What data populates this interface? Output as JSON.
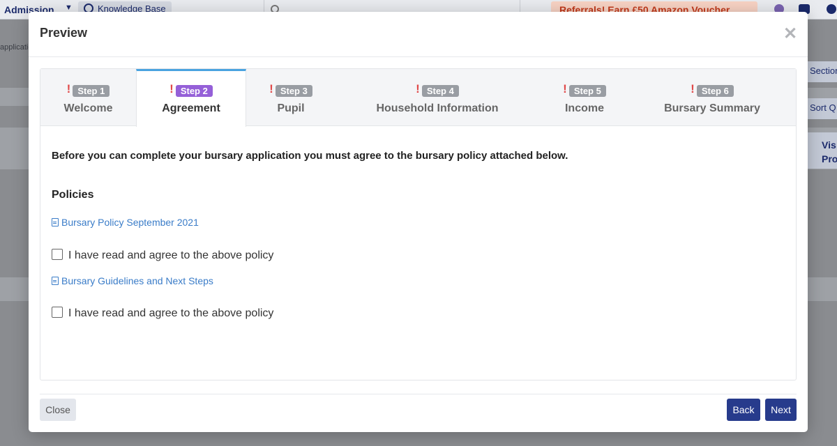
{
  "background": {
    "app_menu": "Admission",
    "knowledge_base": "Knowledge Base",
    "referral_banner": "Referrals! Earn £50 Amazon Voucher",
    "left_partial_text": "applicatio",
    "right_button_1": "Section",
    "right_button_2": "Sort Q",
    "right_column_line1": "Vis",
    "right_column_line2": "Pro"
  },
  "modal": {
    "title": "Preview",
    "tabs": [
      {
        "step": "Step 1",
        "label": "Welcome",
        "warning": "!"
      },
      {
        "step": "Step 2",
        "label": "Agreement",
        "warning": "!"
      },
      {
        "step": "Step 3",
        "label": "Pupil",
        "warning": "!"
      },
      {
        "step": "Step 4",
        "label": "Household Information",
        "warning": "!"
      },
      {
        "step": "Step 5",
        "label": "Income",
        "warning": "!"
      },
      {
        "step": "Step 6",
        "label": "Bursary Summary",
        "warning": "!"
      }
    ],
    "active_tab": "Step 2",
    "intro": "Before you can complete your bursary application you must agree to the bursary policy attached below.",
    "policies_heading": "Policies",
    "policies": [
      {
        "link": "Bursary Policy September 2021",
        "agree_label": "I have read and agree to the above policy",
        "checked": false
      },
      {
        "link": "Bursary Guidelines and Next Steps",
        "agree_label": "I have read and agree to the above policy",
        "checked": false
      }
    ],
    "buttons": {
      "close": "Close",
      "back": "Back",
      "next": "Next"
    }
  },
  "colors": {
    "accent": "#273b8c",
    "active_step_badge": "#9560d8",
    "inactive_step_badge": "#999da3",
    "warning": "#e04848",
    "link": "#3a7cc8",
    "active_tab_border": "#4aa3e0"
  }
}
